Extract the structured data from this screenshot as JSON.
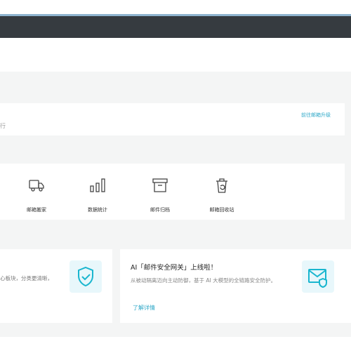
{
  "upgrade_card": {
    "partial_text": "行",
    "link_label": "前往邮箱升级"
  },
  "tools": [
    {
      "label": "邮箱搬家",
      "icon": "truck-icon"
    },
    {
      "label": "数据统计",
      "icon": "bar-chart-icon"
    },
    {
      "label": "邮件归档",
      "icon": "archive-box-icon"
    },
    {
      "label": "邮箱回收站",
      "icon": "recycle-bin-icon"
    }
  ],
  "feature_left": {
    "partial_text": "心板块，分类更清晰，",
    "icon": "shield-check-icon"
  },
  "feature_right": {
    "title": "AI「邮件安全网关」上线啦！",
    "description": "从被动隔离迈向主动防御，基于 AI 大模型的全链路安全防护。",
    "link_label": "了解详情",
    "icon": "mail-shield-icon"
  },
  "colors": {
    "accent": "#2fa8c8",
    "topbar": "#363b40",
    "background": "#f4f5f5"
  }
}
